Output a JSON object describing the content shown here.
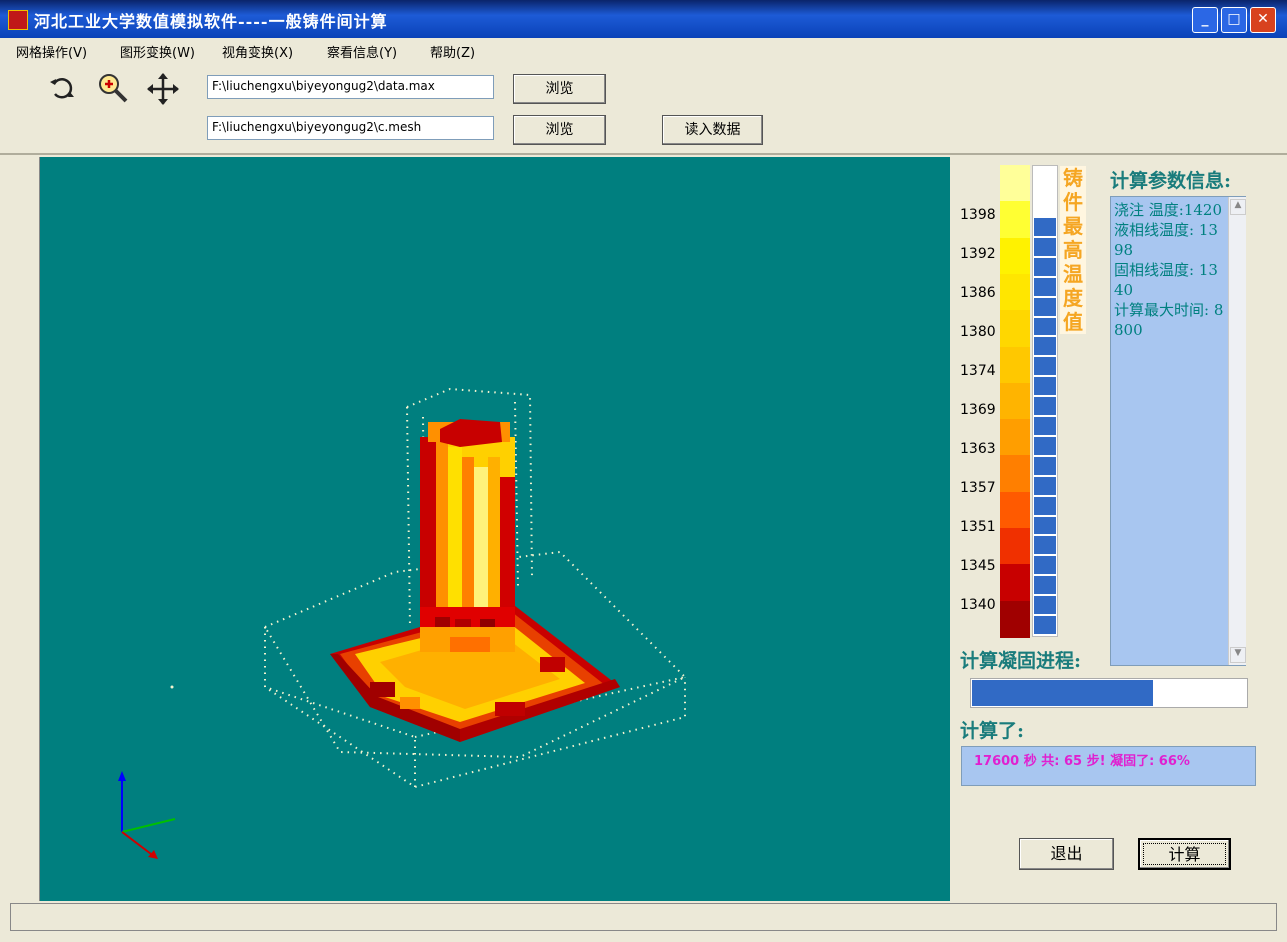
{
  "window": {
    "title": "河北工业大学数值模拟软件----一般铸件间计算",
    "minimize": "_",
    "maximize": "□",
    "close": "✕"
  },
  "menu": [
    {
      "label": "网格操作(V)"
    },
    {
      "label": "图形变换(W)"
    },
    {
      "label": "视角变换(X)"
    },
    {
      "label": "察看信息(Y)"
    },
    {
      "label": "帮助(Z)"
    }
  ],
  "toolbar": {
    "icons": [
      "rotate-icon",
      "zoom-icon",
      "pan-icon"
    ],
    "data_path": "F:\\liuchengxu\\biyeyongug2\\data.max",
    "mesh_path": "F:\\liuchengxu\\biyeyongug2\\c.mesh",
    "browse_label_1": "浏览",
    "browse_label_2": "浏览",
    "read_data_label": "读入数据"
  },
  "legend": {
    "title": "铸件最高温度值",
    "ticks": [
      "1398",
      "1392",
      "1386",
      "1380",
      "1374",
      "1369",
      "1363",
      "1357",
      "1351",
      "1345",
      "1340"
    ],
    "colors": [
      "#ffff99",
      "#ffff33",
      "#fff200",
      "#ffe600",
      "#ffd700",
      "#ffc800",
      "#ffb400",
      "#ff9e00",
      "#ff7f00",
      "#ff5a00",
      "#f03000",
      "#c80000",
      "#a00000"
    ]
  },
  "params": {
    "title": "计算参数信息:",
    "text": "浇注 温度:1420\n液相线温度: 1398\n固相线温度: 1340\n计算最大时间: 8800"
  },
  "progress": {
    "title": "计算凝固进程:",
    "fraction": 0.66
  },
  "result": {
    "title": "计算了:",
    "status": "17600 秒  共: 65 步! 凝固了: 66%"
  },
  "buttons": {
    "exit": "退出",
    "compute": "计算"
  },
  "colors": {
    "viewport_bg": "#007f7f",
    "dark_red": "#b00000",
    "red": "#e02000",
    "orange": "#ff9000",
    "yellow": "#ffe000",
    "light_yellow": "#fff27a"
  }
}
